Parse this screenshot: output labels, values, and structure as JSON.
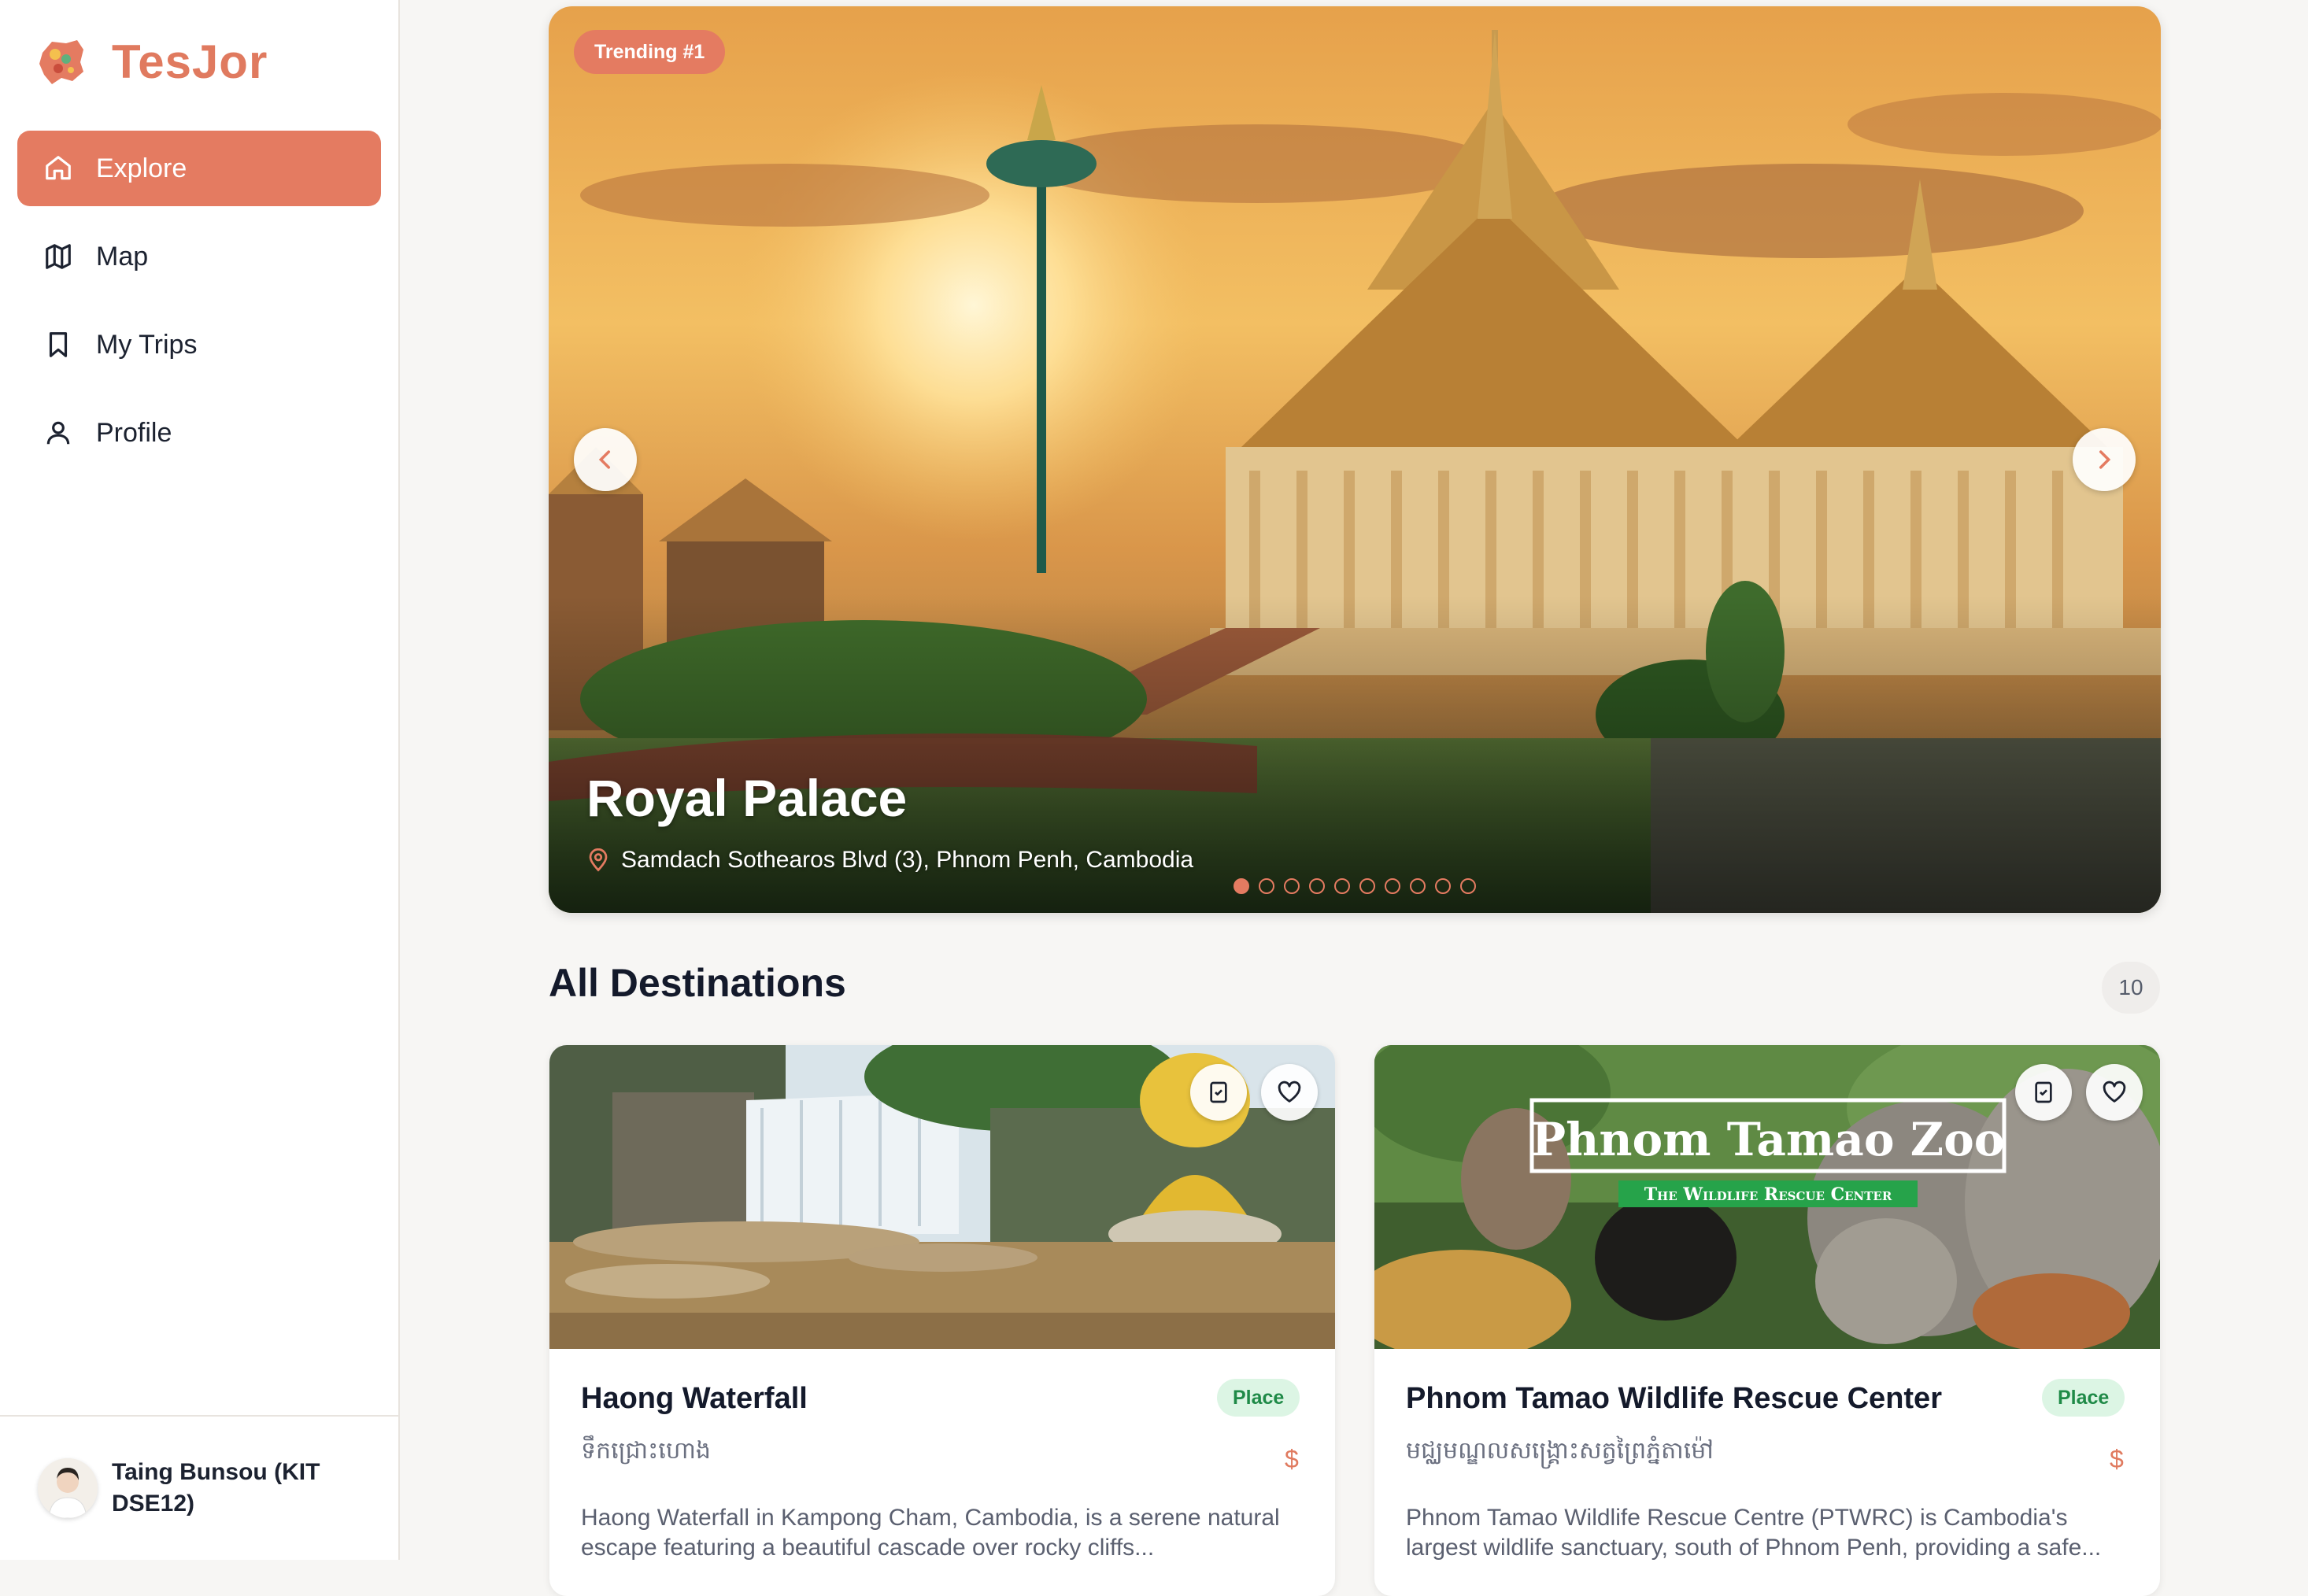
{
  "brand": {
    "name": "TesJor"
  },
  "nav": {
    "items": [
      {
        "label": "Explore",
        "icon": "home-icon",
        "active": true
      },
      {
        "label": "Map",
        "icon": "map-icon",
        "active": false
      },
      {
        "label": "My Trips",
        "icon": "bookmark-icon",
        "active": false
      },
      {
        "label": "Profile",
        "icon": "user-icon",
        "active": false
      }
    ]
  },
  "user": {
    "name": "Taing Bunsou (KIT DSE12)"
  },
  "hero": {
    "badge": "Trending #1",
    "title": "Royal Palace",
    "location": "Samdach Sothearos Blvd (3), Phnom Penh, Cambodia",
    "slide_count": 10,
    "active_slide": 1
  },
  "destinations": {
    "title": "All Destinations",
    "count": "10",
    "cards": [
      {
        "name": "Haong Waterfall",
        "type": "Place",
        "khmer": "ទឹកជ្រោះហោង",
        "price": "$",
        "description": "Haong Waterfall in Kampong Cham, Cambodia, is a serene natural escape featuring a beautiful cascade over rocky cliffs..."
      },
      {
        "name": "Phnom Tamao Wildlife Rescue Center",
        "type": "Place",
        "khmer": "មជ្ឈមណ្ឌលសង្គ្រោះសត្វព្រៃភ្នំតាម៉ៅ",
        "price": "$",
        "description": "Phnom Tamao Wildlife Rescue Centre (PTWRC) is Cambodia's largest wildlife sanctuary, south of Phnom Penh, providing a safe...",
        "image_text": {
          "title": "Phnom Tamao Zoo",
          "subtitle": "The Wildlife Rescue Center"
        }
      }
    ]
  },
  "colors": {
    "accent": "#e47b61",
    "badge_green_bg": "#dcf5e4",
    "badge_green_text": "#1f8a47"
  }
}
